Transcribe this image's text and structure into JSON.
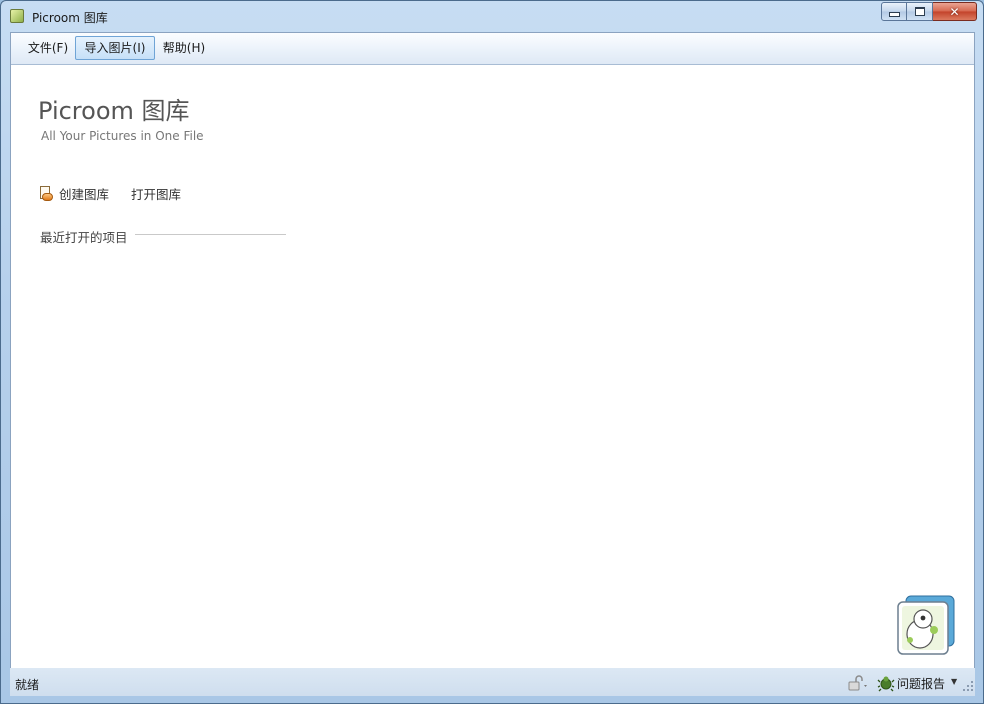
{
  "window": {
    "title": "Picroom 图库",
    "close_glyph": "✕"
  },
  "menu": {
    "items": [
      {
        "label": "文件(F)"
      },
      {
        "label": "导入图片(I)"
      },
      {
        "label": "帮助(H)"
      }
    ]
  },
  "home": {
    "title": "Picroom 图库",
    "subtitle": "All Your Pictures in One File",
    "actions": {
      "create": "创建图库",
      "open": "打开图库"
    },
    "recent_label": "最近打开的项目"
  },
  "statusbar": {
    "status": "就绪",
    "report": "问题报告",
    "report_arrow": "▼"
  },
  "icons": {
    "app": "app-icon",
    "create": "new-library-icon",
    "lock": "lock-icon",
    "bug": "bug-icon",
    "mascot": "mascot-icon"
  },
  "colors": {
    "accent": "#6fa4d6",
    "close": "#c3422a"
  }
}
